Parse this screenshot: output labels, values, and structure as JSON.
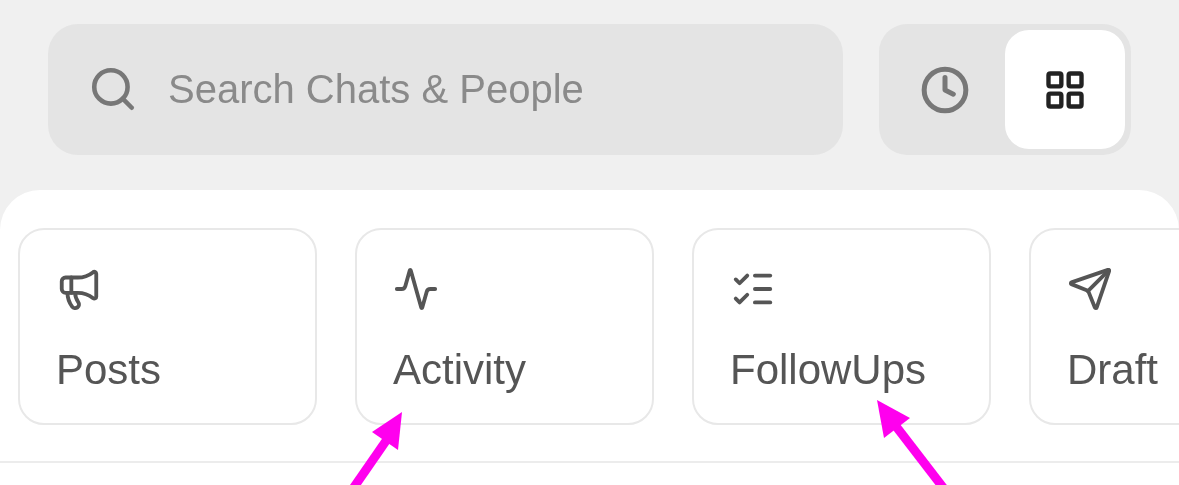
{
  "search": {
    "placeholder": "Search Chats & People"
  },
  "view_toggle": [
    {
      "kind": "history",
      "selected": false
    },
    {
      "kind": "grid",
      "selected": true
    }
  ],
  "cards": [
    {
      "kind": "posts",
      "label": "Posts"
    },
    {
      "kind": "activity",
      "label": "Activity"
    },
    {
      "kind": "followups",
      "label": "FollowUps"
    },
    {
      "kind": "drafts",
      "label": "Draft"
    }
  ]
}
